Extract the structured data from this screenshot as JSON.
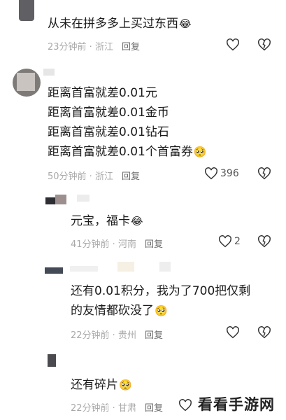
{
  "comments": [
    {
      "lines": [
        "从未在拼多多上买过东西"
      ],
      "emoji": [
        "",
        ""
      ],
      "time": "23分钟前",
      "location": "浙江",
      "reply": "回复",
      "likes": ""
    },
    {
      "lines": [
        "距离首富就差0.01元",
        "距离首富就差0.01金币",
        "距离首富就差0.01钻石",
        "距离首富就差0.01个首富券"
      ],
      "time": "50分钟前",
      "location": "浙江",
      "reply": "回复",
      "likes": "396"
    },
    {
      "lines": [
        "元宝，福卡"
      ],
      "time": "41分钟前",
      "location": "河南",
      "reply": "回复",
      "likes": "2"
    },
    {
      "lines": [
        "还有0.01积分，我为了700把仅剩",
        "的友情都砍没了"
      ],
      "time": "22分钟前",
      "location": "贵州",
      "reply": "回复",
      "likes": ""
    },
    {
      "lines": [
        "还有碎片"
      ],
      "time": "22分钟前",
      "location": "甘肃",
      "reply": "回复",
      "likes": ""
    }
  ],
  "separator": " · ",
  "watermark": "看看手游网",
  "icons": {
    "like": "heart-icon",
    "dislike": "broken-heart-icon",
    "emoji": [
      "laughing-crying-emoji",
      "teary-face-emoji"
    ]
  },
  "colors": {
    "meta": "#a9a9a9",
    "reply": "#6b6b6b",
    "text": "#1b1b1b"
  }
}
